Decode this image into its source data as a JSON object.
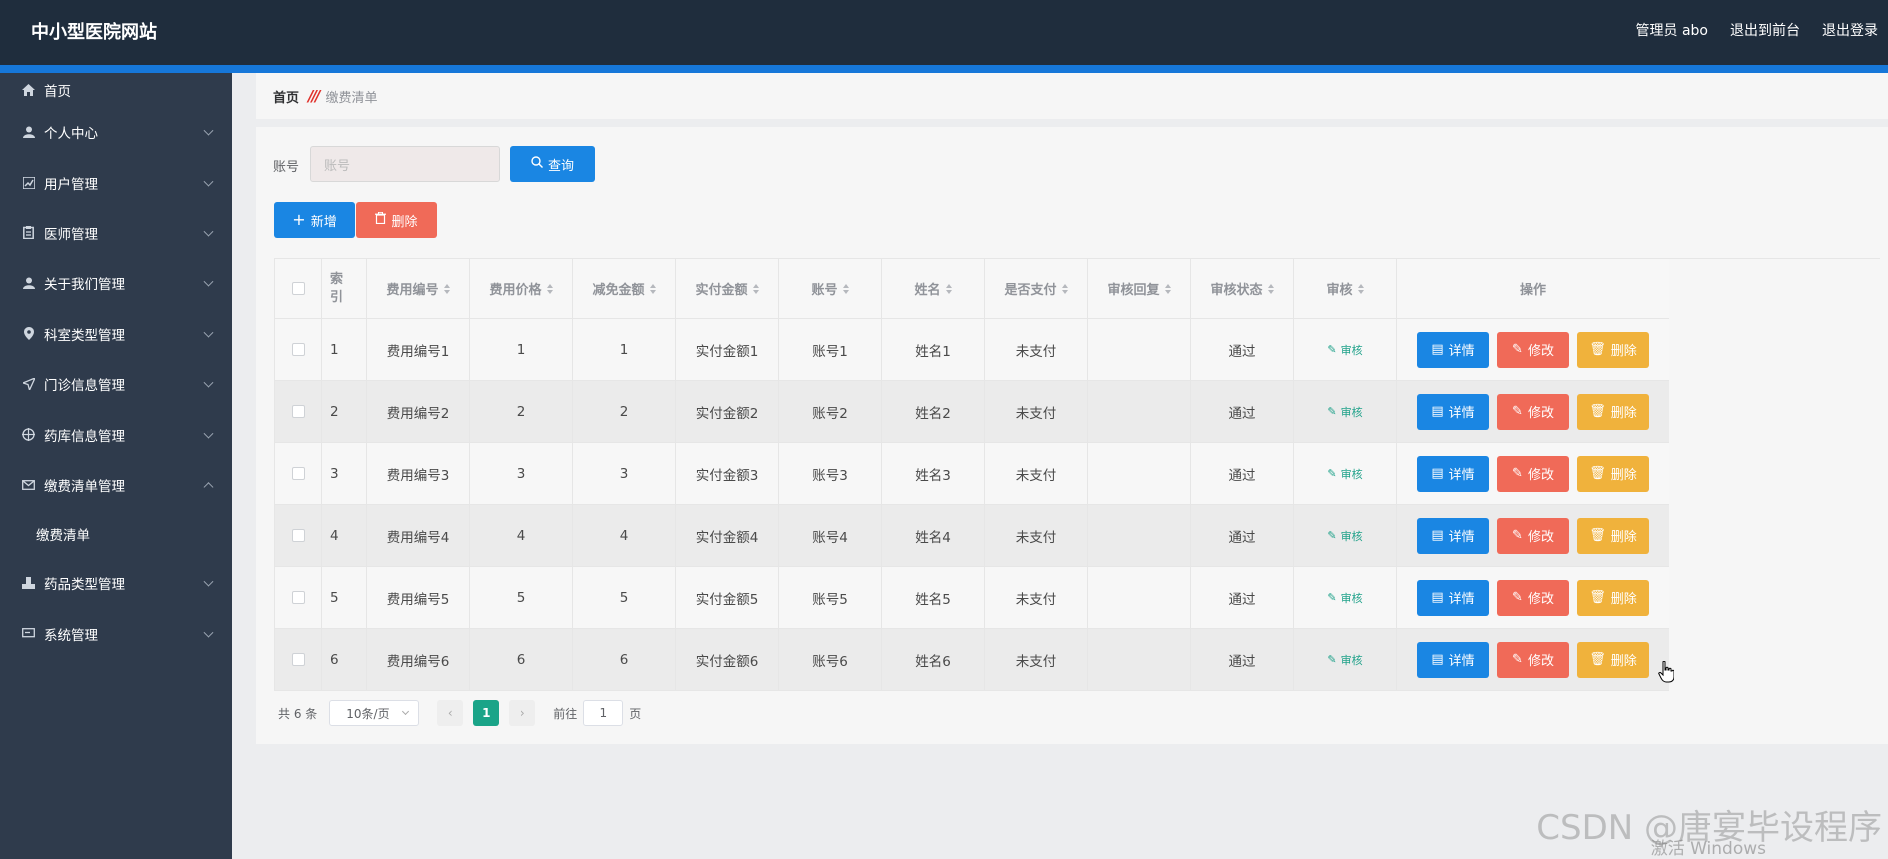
{
  "header": {
    "title": "中小型医院网站",
    "admin": "管理员 abo",
    "to_front": "退出到前台",
    "logout": "退出登录"
  },
  "sidebar": {
    "items": [
      {
        "label": "首页",
        "icon": "home-icon",
        "has_chevron": false
      },
      {
        "label": "个人中心",
        "icon": "user-icon",
        "has_chevron": true
      },
      {
        "label": "用户管理",
        "icon": "chart-icon",
        "has_chevron": true
      },
      {
        "label": "医师管理",
        "icon": "clipboard-icon",
        "has_chevron": true
      },
      {
        "label": "关于我们管理",
        "icon": "user-icon",
        "has_chevron": true
      },
      {
        "label": "科室类型管理",
        "icon": "location-icon",
        "has_chevron": true
      },
      {
        "label": "门诊信息管理",
        "icon": "send-icon",
        "has_chevron": true
      },
      {
        "label": "药库信息管理",
        "icon": "target-icon",
        "has_chevron": true
      },
      {
        "label": "缴费清单管理",
        "icon": "mail-icon",
        "has_chevron": true,
        "expanded": true
      },
      {
        "label": "缴费清单",
        "sub": true
      },
      {
        "label": "药品类型管理",
        "icon": "stamp-icon",
        "has_chevron": true
      },
      {
        "label": "系统管理",
        "icon": "monitor-icon",
        "has_chevron": true
      }
    ]
  },
  "breadcrumb": {
    "home": "首页",
    "current": "缴费清单"
  },
  "search": {
    "label": "账号",
    "placeholder": "账号",
    "query_button": "查询"
  },
  "toolbar": {
    "add_button": "新增",
    "delete_button": "删除"
  },
  "table": {
    "headers": [
      "索引",
      "费用编号",
      "费用价格",
      "减免金额",
      "实付金额",
      "账号",
      "姓名",
      "是否支付",
      "审核回复",
      "审核状态",
      "审核",
      "操作"
    ],
    "rows": [
      {
        "idx": "1",
        "code": "费用编号1",
        "price": "1",
        "discount": "1",
        "paid": "实付金额1",
        "account": "账号1",
        "name": "姓名1",
        "is_paid": "未支付",
        "reply": "",
        "status": "通过"
      },
      {
        "idx": "2",
        "code": "费用编号2",
        "price": "2",
        "discount": "2",
        "paid": "实付金额2",
        "account": "账号2",
        "name": "姓名2",
        "is_paid": "未支付",
        "reply": "",
        "status": "通过"
      },
      {
        "idx": "3",
        "code": "费用编号3",
        "price": "3",
        "discount": "3",
        "paid": "实付金额3",
        "account": "账号3",
        "name": "姓名3",
        "is_paid": "未支付",
        "reply": "",
        "status": "通过"
      },
      {
        "idx": "4",
        "code": "费用编号4",
        "price": "4",
        "discount": "4",
        "paid": "实付金额4",
        "account": "账号4",
        "name": "姓名4",
        "is_paid": "未支付",
        "reply": "",
        "status": "通过"
      },
      {
        "idx": "5",
        "code": "费用编号5",
        "price": "5",
        "discount": "5",
        "paid": "实付金额5",
        "account": "账号5",
        "name": "姓名5",
        "is_paid": "未支付",
        "reply": "",
        "status": "通过"
      },
      {
        "idx": "6",
        "code": "费用编号6",
        "price": "6",
        "discount": "6",
        "paid": "实付金额6",
        "account": "账号6",
        "name": "姓名6",
        "is_paid": "未支付",
        "reply": "",
        "status": "通过"
      }
    ],
    "audit_link": "审核",
    "detail_button": "详情",
    "edit_button": "修改",
    "delete_button": "删除"
  },
  "pagination": {
    "total": "共 6 条",
    "page_size": "10条/页",
    "current_page": "1",
    "goto_label": "前往",
    "goto_value": "1",
    "page_suffix": "页"
  },
  "overlay": {
    "watermark": "CSDN @唐宴毕设程序",
    "activate_windows": "激活 Windows"
  },
  "colors": {
    "header_bg": "#1f2d3d",
    "sidebar_bg": "#2f3b4c",
    "primary": "#1a86e3",
    "danger": "#f06a58",
    "warning": "#f0b23c",
    "success": "#1aa488"
  }
}
